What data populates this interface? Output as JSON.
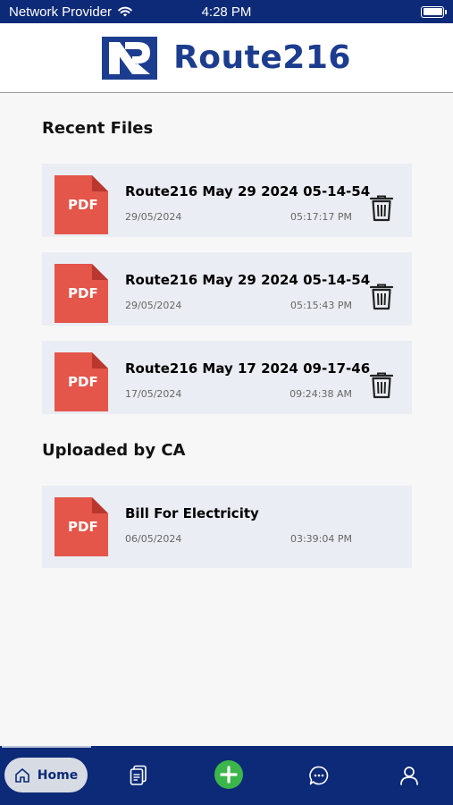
{
  "status_bar": {
    "carrier": "Network Provider",
    "time": "4:28 PM"
  },
  "header": {
    "brand_name": "Route216"
  },
  "recent_files": {
    "title": "Recent Files",
    "items": [
      {
        "name": "Route216 May 29 2024 05-14-54",
        "date": "29/05/2024",
        "time": "05:17:17 PM",
        "icon_label": "PDF"
      },
      {
        "name": "Route216 May 29 2024 05-14-54",
        "date": "29/05/2024",
        "time": "05:15:43 PM",
        "icon_label": "PDF"
      },
      {
        "name": "Route216 May 17 2024 09-17-46",
        "date": "17/05/2024",
        "time": "09:24:38 AM",
        "icon_label": "PDF"
      }
    ]
  },
  "uploaded_by_ca": {
    "title": "Uploaded by CA",
    "items": [
      {
        "name": "Bill For Electricity",
        "date": "06/05/2024",
        "time": "03:39:04 PM",
        "icon_label": "PDF"
      }
    ]
  },
  "bottom_nav": {
    "home_label": "Home"
  },
  "colors": {
    "primary": "#0d2a78",
    "brand_text": "#1c3d8f",
    "pdf_red": "#e4554a",
    "add_green": "#3cb54a",
    "card_bg": "#eaedf3"
  }
}
